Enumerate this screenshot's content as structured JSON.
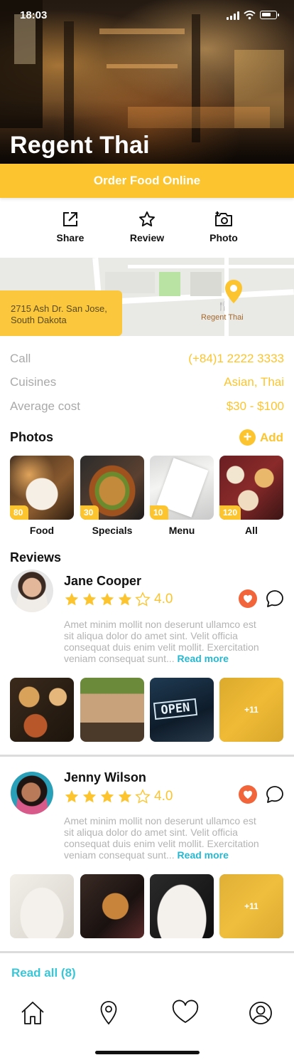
{
  "status_bar": {
    "time": "18:03"
  },
  "restaurant": {
    "name": "Regent Thai"
  },
  "order_button": {
    "label": "Order Food Online"
  },
  "actions": [
    {
      "label": "Share",
      "icon": "share-icon"
    },
    {
      "label": "Review",
      "icon": "star-outline-icon"
    },
    {
      "label": "Photo",
      "icon": "camera-icon"
    }
  ],
  "map": {
    "address": "2715 Ash Dr. San Jose, South Dakota",
    "pin_label": "Regent Thai"
  },
  "info": [
    {
      "key": "Call",
      "value": "(+84)1 2222 3333"
    },
    {
      "key": "Cuisines",
      "value": "Asian, Thai"
    },
    {
      "key": "Average cost",
      "value": "$30 - $100"
    }
  ],
  "photos": {
    "title": "Photos",
    "add_label": "Add",
    "items": [
      {
        "caption": "Food",
        "count": "80"
      },
      {
        "caption": "Specials",
        "count": "30"
      },
      {
        "caption": "Menu",
        "count": "10"
      },
      {
        "caption": "All",
        "count": "120"
      }
    ]
  },
  "reviews": {
    "title": "Reviews",
    "items": [
      {
        "name": "Jane Cooper",
        "rating": "4.0",
        "stars": 4,
        "text": "Amet minim mollit non deserunt ullamco est sit aliqua dolor do amet sint. Velit officia consequat duis enim velit mollit. Exercitation veniam consequat sunt...",
        "read_more": "Read more",
        "more_photos": "+11"
      },
      {
        "name": "Jenny Wilson",
        "rating": "4.0",
        "stars": 4,
        "text": "Amet minim mollit non deserunt ullamco est sit aliqua dolor do amet sint. Velit officia consequat duis enim velit mollit. Exercitation veniam consequat sunt...",
        "read_more": "Read more",
        "more_photos": "+11"
      }
    ],
    "read_all": "Read all (8)"
  },
  "tabbar": [
    "home-icon",
    "location-pin-icon",
    "heart-icon",
    "profile-icon"
  ],
  "colors": {
    "accent": "#fcc52f",
    "link": "#26b8d0",
    "heart": "#f2643a",
    "muted": "#a9a9a9"
  }
}
